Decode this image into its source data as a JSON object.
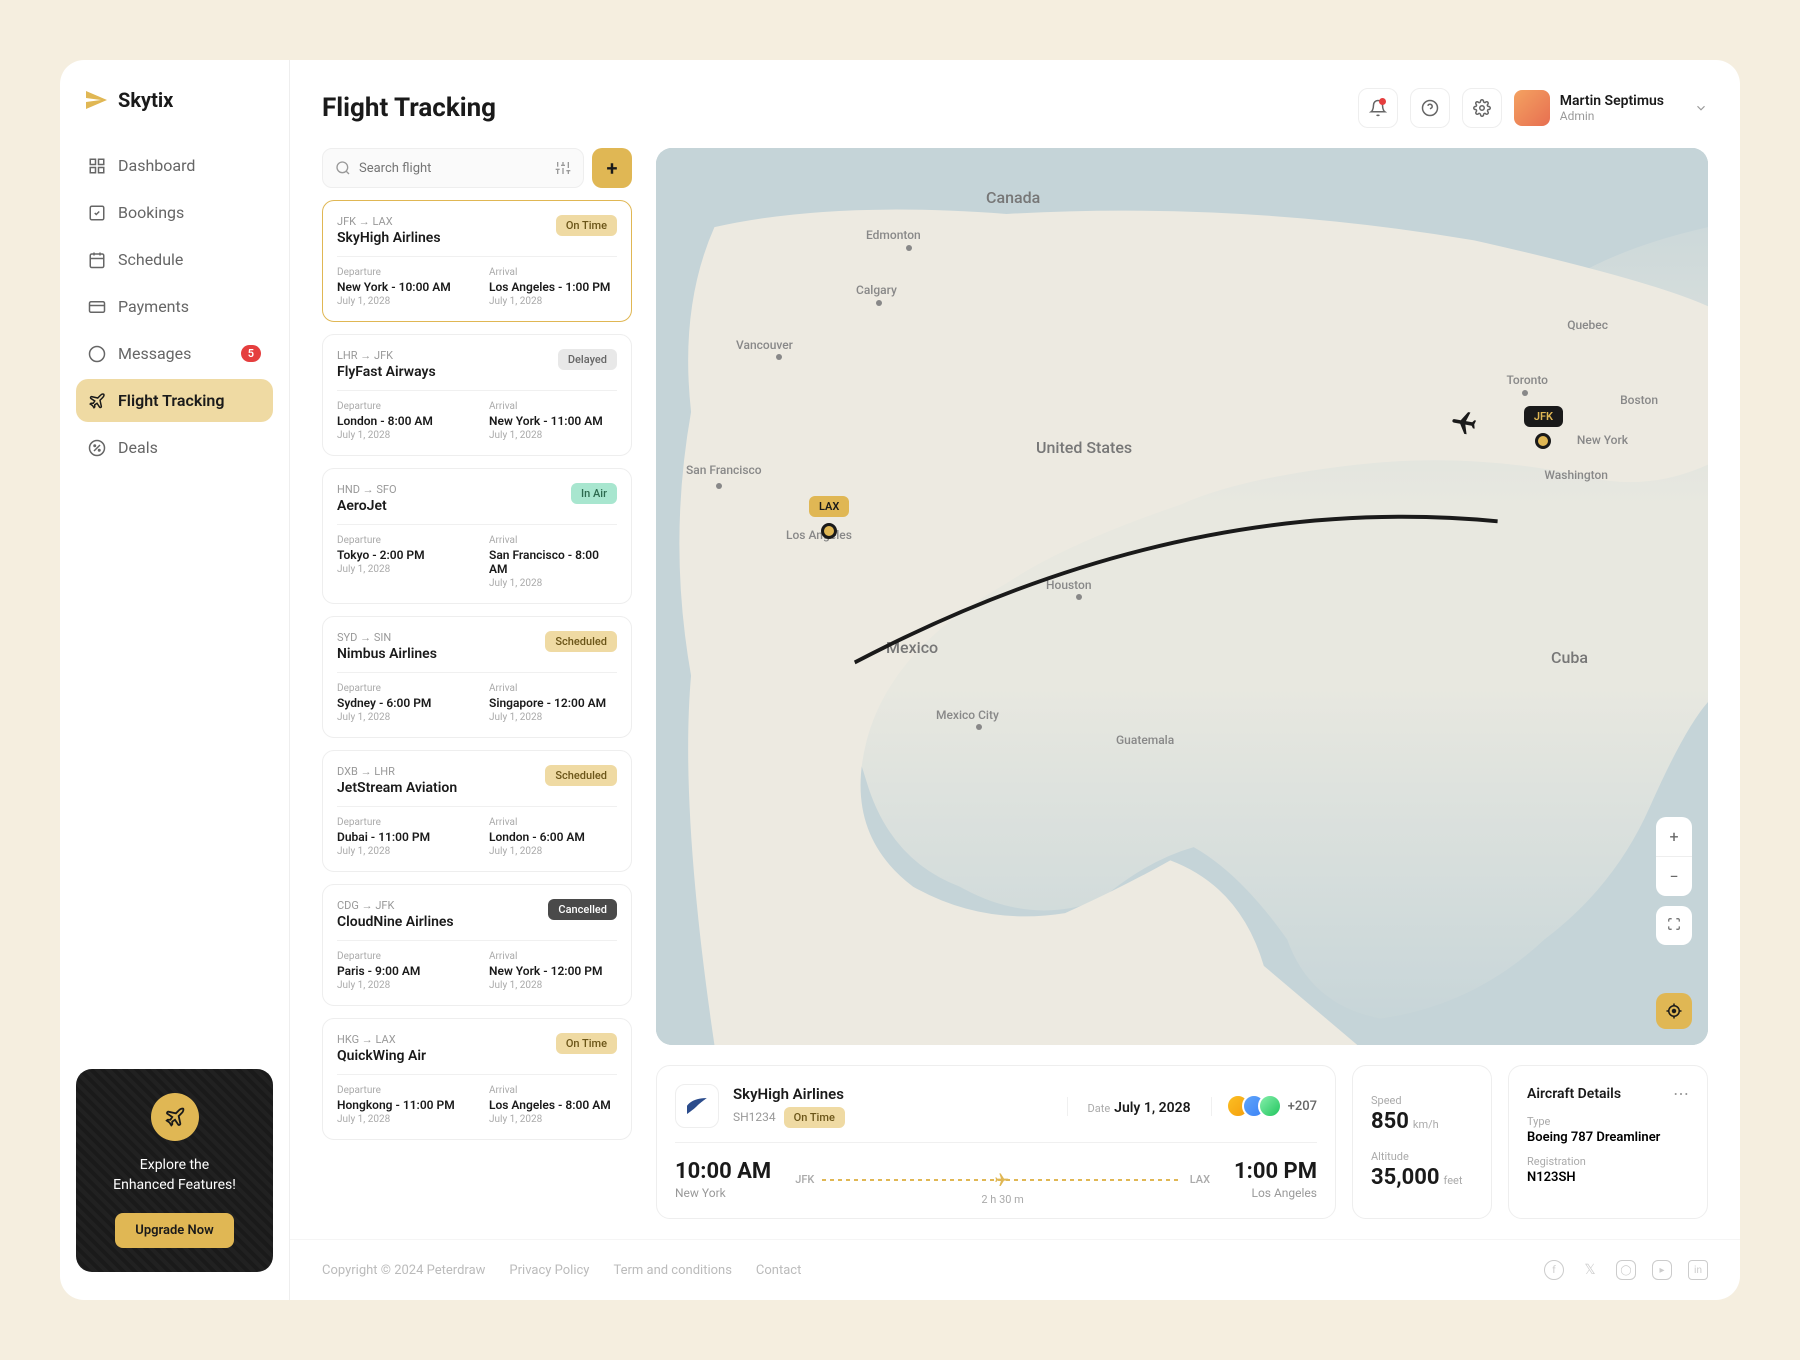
{
  "brand": "Skytix",
  "page_title": "Flight Tracking",
  "nav": {
    "items": [
      {
        "label": "Dashboard"
      },
      {
        "label": "Bookings"
      },
      {
        "label": "Schedule"
      },
      {
        "label": "Payments"
      },
      {
        "label": "Messages",
        "badge": "5"
      },
      {
        "label": "Flight Tracking"
      },
      {
        "label": "Deals"
      }
    ]
  },
  "promo": {
    "line1": "Explore the",
    "line2": "Enhanced Features!",
    "button": "Upgrade Now"
  },
  "user": {
    "name": "Martin Septimus",
    "role": "Admin"
  },
  "search": {
    "placeholder": "Search flight"
  },
  "flights": [
    {
      "route": "JFK → LAX",
      "airline": "SkyHigh Airlines",
      "status": "On Time",
      "status_class": "st-ontime",
      "dep": "New York - 10:00 AM",
      "dep_date": "July 1, 2028",
      "arr": "Los Angeles - 1:00 PM",
      "arr_date": "July 1, 2028"
    },
    {
      "route": "LHR → JFK",
      "airline": "FlyFast Airways",
      "status": "Delayed",
      "status_class": "st-delayed",
      "dep": "London - 8:00 AM",
      "dep_date": "July 1, 2028",
      "arr": "New York - 11:00 AM",
      "arr_date": "July 1, 2028"
    },
    {
      "route": "HND → SFO",
      "airline": "AeroJet",
      "status": "In Air",
      "status_class": "st-inair",
      "dep": "Tokyo - 2:00 PM",
      "dep_date": "July 1, 2028",
      "arr": "San Francisco - 8:00 AM",
      "arr_date": "July 1, 2028"
    },
    {
      "route": "SYD → SIN",
      "airline": "Nimbus Airlines",
      "status": "Scheduled",
      "status_class": "st-scheduled",
      "dep": "Sydney - 6:00 PM",
      "dep_date": "July 1, 2028",
      "arr": "Singapore - 12:00 AM",
      "arr_date": "July 1, 2028"
    },
    {
      "route": "DXB → LHR",
      "airline": "JetStream Aviation",
      "status": "Scheduled",
      "status_class": "st-scheduled",
      "dep": "Dubai - 11:00 PM",
      "dep_date": "July 1, 2028",
      "arr": "London - 6:00 AM",
      "arr_date": "July 1, 2028"
    },
    {
      "route": "CDG → JFK",
      "airline": "CloudNine Airlines",
      "status": "Cancelled",
      "status_class": "st-cancelled",
      "dep": "Paris - 9:00 AM",
      "dep_date": "July 1, 2028",
      "arr": "New York - 12:00 PM",
      "arr_date": "July 1, 2028"
    },
    {
      "route": "HKG → LAX",
      "airline": "QuickWing Air",
      "status": "On Time",
      "status_class": "st-ontime",
      "dep": "Hongkong - 11:00 PM",
      "dep_date": "July 1, 2028",
      "arr": "Los Angeles - 8:00 AM",
      "arr_date": "July 1, 2028"
    }
  ],
  "labels": {
    "departure": "Departure",
    "arrival": "Arrival"
  },
  "map": {
    "labels": {
      "canada": "Canada",
      "edmonton": "Edmonton",
      "calgary": "Calgary",
      "vancouver": "Vancouver",
      "quebec": "Quebec",
      "toronto": "Toronto",
      "boston": "Boston",
      "newyork": "New York",
      "washington": "Washington",
      "sanfrancisco": "San Francisco",
      "losangeles": "Los Angeles",
      "us": "United States",
      "houston": "Houston",
      "mexico": "Mexico",
      "mexicocity": "Mexico City",
      "guatemala": "Guatemala",
      "cuba": "Cuba"
    },
    "airports": {
      "jfk": "JFK",
      "lax": "LAX"
    }
  },
  "detail": {
    "airline": "SkyHigh Airlines",
    "flight": "SH1234",
    "status": "On Time",
    "date_label": "Date",
    "date": "July 1, 2028",
    "pax": "+207",
    "dep_time": "10:00 AM",
    "dep_city": "New York",
    "dep_code": "JFK",
    "arr_code": "LAX",
    "arr_time": "1:00 PM",
    "arr_city": "Los Angeles",
    "duration": "2 h 30 m"
  },
  "stats": {
    "speed_label": "Speed",
    "speed": "850",
    "speed_unit": "km/h",
    "alt_label": "Altitude",
    "alt": "35,000",
    "alt_unit": "feet"
  },
  "aircraft": {
    "title": "Aircraft Details",
    "type_label": "Type",
    "type": "Boeing 787 Dreamliner",
    "reg_label": "Registration",
    "reg": "N123SH"
  },
  "footer": {
    "copyright": "Copyright © 2024 Peterdraw",
    "privacy": "Privacy Policy",
    "terms": "Term and conditions",
    "contact": "Contact"
  }
}
